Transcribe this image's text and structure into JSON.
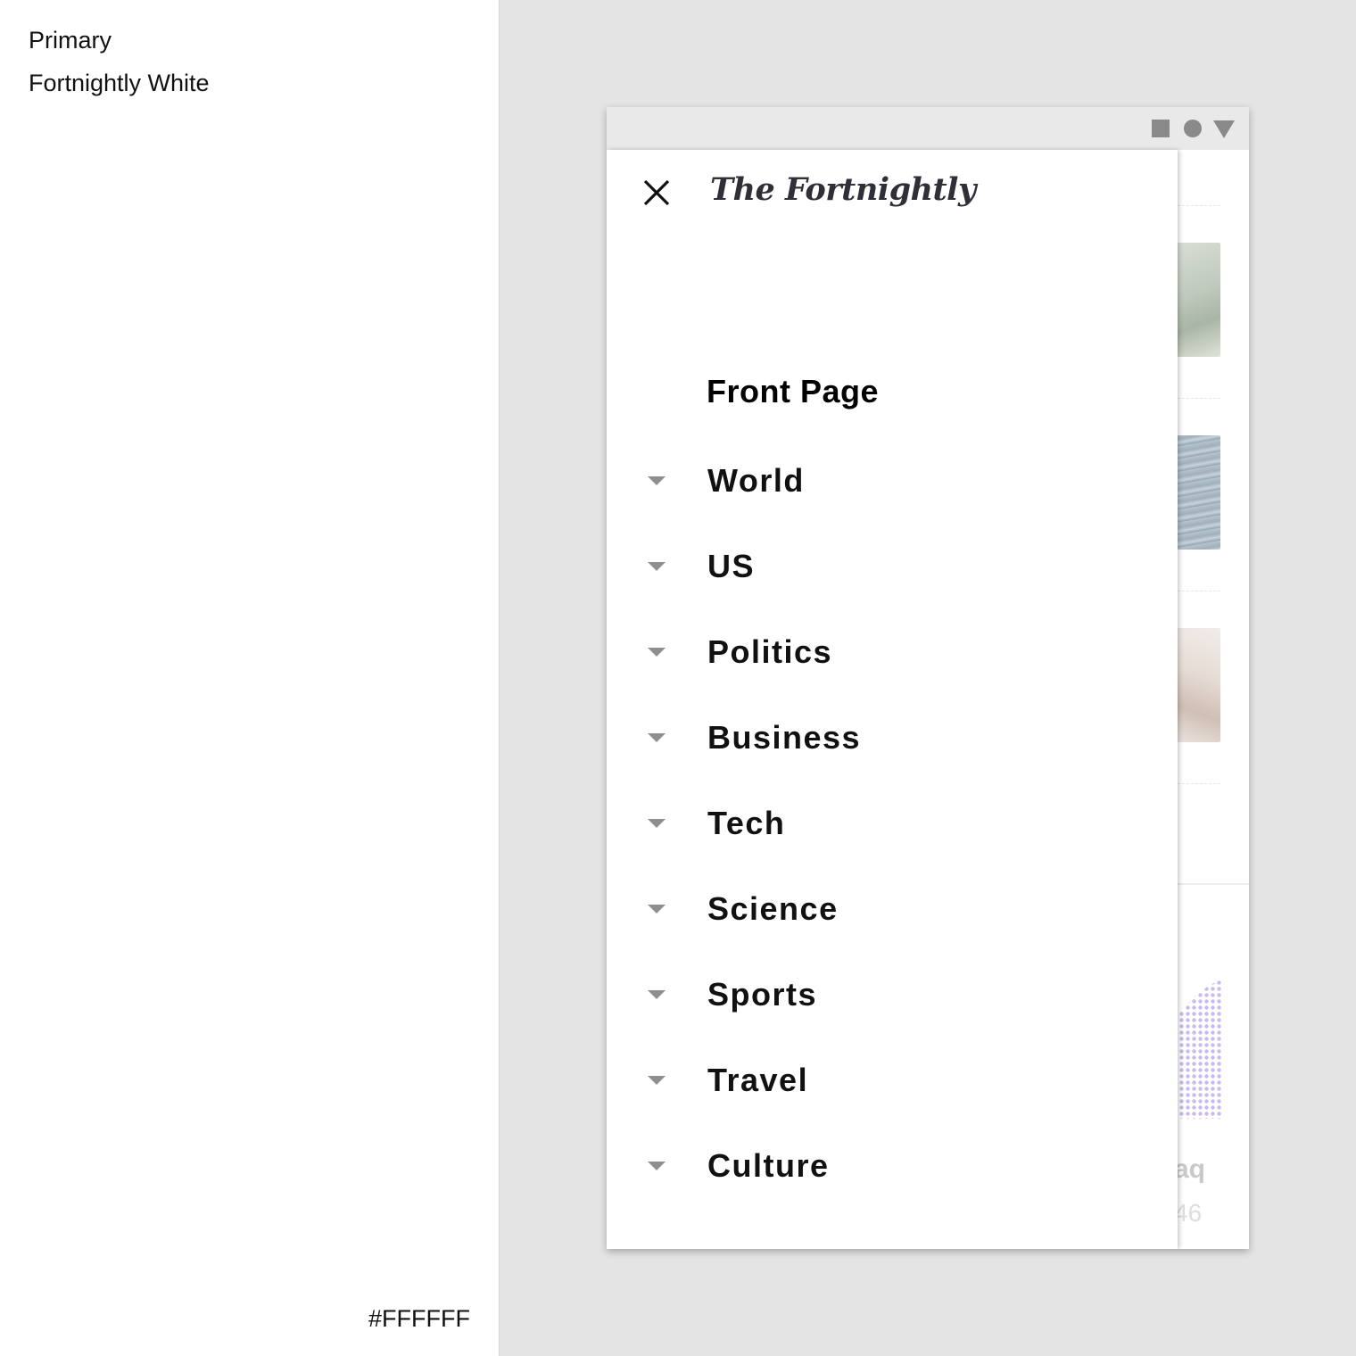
{
  "swatch": {
    "role": "Primary",
    "name": "Fortnightly White",
    "hex": "#FFFFFF"
  },
  "status_bar": {
    "icons": [
      "square-icon",
      "circle-icon",
      "triangle-icon"
    ]
  },
  "background": {
    "ticker": "aq",
    "price": "46",
    "chart_color": "#c9b8f2"
  },
  "drawer": {
    "close_icon": "close-icon",
    "brand": "The Fortnightly",
    "front_page": "Front Page",
    "sections": [
      {
        "label": "World"
      },
      {
        "label": "US"
      },
      {
        "label": "Politics"
      },
      {
        "label": "Business"
      },
      {
        "label": "Tech"
      },
      {
        "label": "Science"
      },
      {
        "label": "Sports"
      },
      {
        "label": "Travel"
      },
      {
        "label": "Culture"
      }
    ]
  },
  "colors": {
    "primary": "#FFFFFF",
    "canvas": "#E4E4E4",
    "text": "#111111",
    "arrow": "#8E8E8E"
  }
}
